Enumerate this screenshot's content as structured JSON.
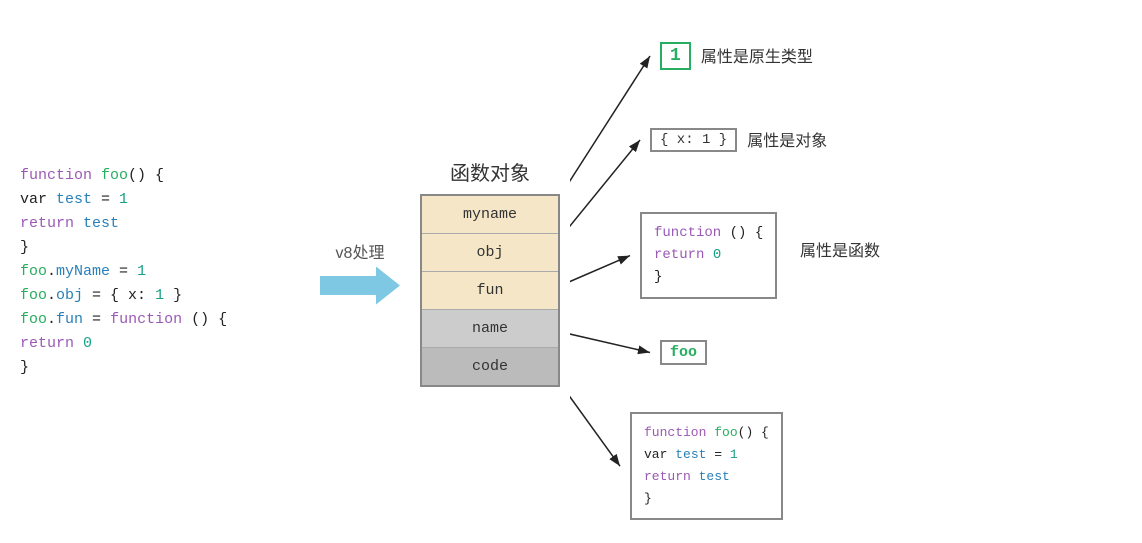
{
  "code": {
    "lines": [
      {
        "parts": [
          {
            "text": "function",
            "class": "kw-purple"
          },
          {
            "text": " ",
            "class": "text-black"
          },
          {
            "text": "foo",
            "class": "kw-green"
          },
          {
            "text": "() {",
            "class": "text-black"
          }
        ]
      },
      {
        "parts": [
          {
            "text": "    var ",
            "class": "text-black"
          },
          {
            "text": "test",
            "class": "kw-blue"
          },
          {
            "text": " = ",
            "class": "text-black"
          },
          {
            "text": "1",
            "class": "kw-teal"
          }
        ]
      },
      {
        "parts": [
          {
            "text": "    ",
            "class": "text-black"
          },
          {
            "text": "return",
            "class": "kw-purple"
          },
          {
            "text": " test",
            "class": "kw-blue"
          }
        ]
      },
      {
        "parts": [
          {
            "text": "}",
            "class": "text-black"
          }
        ]
      },
      {
        "parts": [
          {
            "text": "foo",
            "class": "kw-green"
          },
          {
            "text": ".",
            "class": "text-black"
          },
          {
            "text": "myName",
            "class": "kw-blue"
          },
          {
            "text": " = ",
            "class": "text-black"
          },
          {
            "text": "1",
            "class": "kw-teal"
          }
        ]
      },
      {
        "parts": [
          {
            "text": "foo",
            "class": "kw-green"
          },
          {
            "text": ".",
            "class": "text-black"
          },
          {
            "text": "obj",
            "class": "kw-blue"
          },
          {
            "text": " = { x: ",
            "class": "text-black"
          },
          {
            "text": "1",
            "class": "kw-teal"
          },
          {
            "text": " }",
            "class": "text-black"
          }
        ]
      },
      {
        "parts": [
          {
            "text": "foo",
            "class": "kw-green"
          },
          {
            "text": ".",
            "class": "text-black"
          },
          {
            "text": "fun",
            "class": "kw-blue"
          },
          {
            "text": " = ",
            "class": "text-black"
          },
          {
            "text": "function",
            "class": "kw-purple"
          },
          {
            "text": " () {",
            "class": "text-black"
          }
        ]
      },
      {
        "parts": [
          {
            "text": "    ",
            "class": "text-black"
          },
          {
            "text": "return",
            "class": "kw-purple"
          },
          {
            "text": " ",
            "class": "text-black"
          },
          {
            "text": "0",
            "class": "kw-teal"
          }
        ]
      },
      {
        "parts": [
          {
            "text": "}",
            "class": "text-black"
          }
        ]
      }
    ]
  },
  "arrow": {
    "label": "v8处理"
  },
  "func_obj": {
    "title": "函数对象",
    "rows": [
      {
        "id": "myname",
        "label": "myname",
        "class": "row-myname"
      },
      {
        "id": "obj",
        "label": "obj",
        "class": "row-obj"
      },
      {
        "id": "fun",
        "label": "fun",
        "class": "row-fun"
      },
      {
        "id": "name",
        "label": "name",
        "class": "row-name"
      },
      {
        "id": "code",
        "label": "code",
        "class": "row-code"
      }
    ]
  },
  "annotations": {
    "primitive": {
      "value": "1",
      "label": "属性是原生类型"
    },
    "object": {
      "value": "{ x: 1 }",
      "label": "属性是对象"
    },
    "function": {
      "lines": [
        {
          "parts": [
            {
              "text": "function",
              "class": "kw-purple"
            },
            {
              "text": " () {",
              "class": "text-black"
            }
          ]
        },
        {
          "parts": [
            {
              "text": "    ",
              "class": "text-black"
            },
            {
              "text": "return",
              "class": "kw-purple"
            },
            {
              "text": " ",
              "class": "text-black"
            },
            {
              "text": "0",
              "class": "kw-teal"
            }
          ]
        },
        {
          "parts": [
            {
              "text": "}",
              "class": "text-black"
            }
          ]
        }
      ],
      "label": "属性是函数"
    },
    "foo_name": {
      "value": "foo"
    },
    "code": {
      "lines": [
        {
          "parts": [
            {
              "text": "function",
              "class": "kw-purple"
            },
            {
              "text": " ",
              "class": "text-black"
            },
            {
              "text": "foo",
              "class": "kw-green"
            },
            {
              "text": "() {",
              "class": "text-black"
            }
          ]
        },
        {
          "parts": [
            {
              "text": "    var ",
              "class": "text-black"
            },
            {
              "text": "test",
              "class": "kw-blue"
            },
            {
              "text": " = ",
              "class": "text-black"
            },
            {
              "text": "1",
              "class": "kw-teal"
            }
          ]
        },
        {
          "parts": [
            {
              "text": "    ",
              "class": "text-black"
            },
            {
              "text": "return",
              "class": "kw-purple"
            },
            {
              "text": " test",
              "class": "kw-blue"
            }
          ]
        },
        {
          "parts": [
            {
              "text": "}",
              "class": "text-black"
            }
          ]
        }
      ]
    }
  }
}
